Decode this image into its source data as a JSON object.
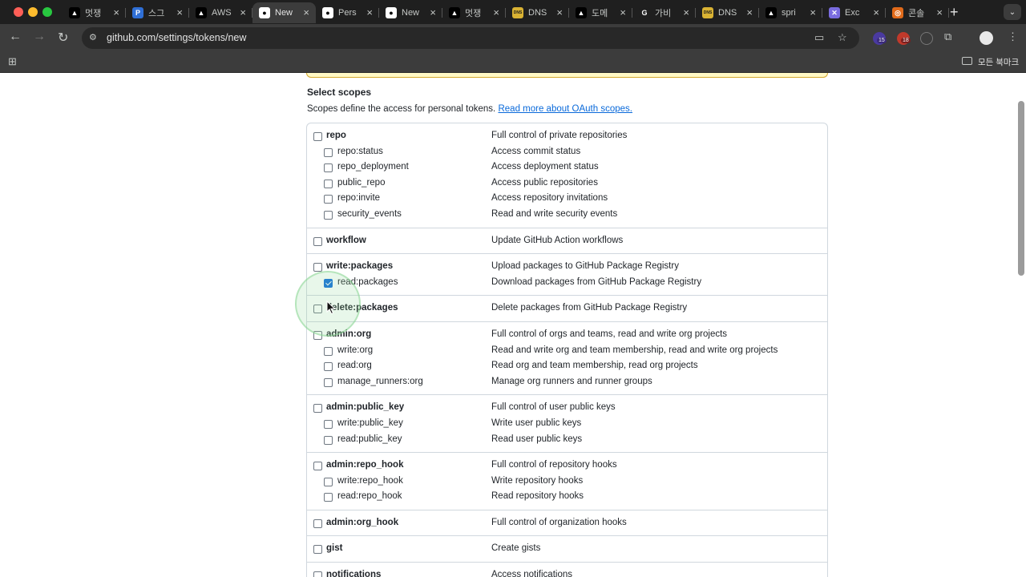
{
  "browser": {
    "tabs": [
      {
        "title": "멋쟁",
        "icon": "triangle-icon",
        "favicon_text": "▲",
        "favicon_bg": "#000000",
        "active": false
      },
      {
        "title": "스그",
        "icon": "p-logo-icon",
        "favicon_text": "P",
        "favicon_bg": "#2f6fd6",
        "active": false
      },
      {
        "title": "AWS",
        "icon": "triangle-icon",
        "favicon_text": "▲",
        "favicon_bg": "#000000",
        "active": false
      },
      {
        "title": "New",
        "icon": "github-icon",
        "favicon_text": "●",
        "favicon_bg": "#ffffff",
        "active": true
      },
      {
        "title": "Pers",
        "icon": "github-icon",
        "favicon_text": "●",
        "favicon_bg": "#ffffff",
        "active": false
      },
      {
        "title": "New",
        "icon": "github-icon",
        "favicon_text": "●",
        "favicon_bg": "#ffffff",
        "active": false
      },
      {
        "title": "멋쟁",
        "icon": "triangle-icon",
        "favicon_text": "▲",
        "favicon_bg": "#000000",
        "active": false
      },
      {
        "title": "DNS",
        "icon": "dns-icon",
        "favicon_text": "DNS",
        "favicon_bg": "#d9b233",
        "active": false
      },
      {
        "title": "도메",
        "icon": "triangle-icon",
        "favicon_text": "▲",
        "favicon_bg": "#000000",
        "active": false
      },
      {
        "title": "가비",
        "icon": "g-letter-icon",
        "favicon_text": "G",
        "favicon_bg": "#1f1f1f",
        "active": false
      },
      {
        "title": "DNS",
        "icon": "dns-icon",
        "favicon_text": "DNS",
        "favicon_bg": "#d9b233",
        "active": false
      },
      {
        "title": "spri",
        "icon": "triangle-icon",
        "favicon_text": "▲",
        "favicon_bg": "#000000",
        "active": false
      },
      {
        "title": "Exc",
        "icon": "excalidraw-icon",
        "favicon_text": "✕",
        "favicon_bg": "#7a6ce0",
        "active": false
      },
      {
        "title": "콘솔",
        "icon": "console-icon",
        "favicon_text": "◎",
        "favicon_bg": "#e06a1a",
        "active": false
      }
    ],
    "url": "github.com/settings/tokens/new",
    "extensions": [
      {
        "icon": "extension-icon",
        "badge": "15",
        "color": "#4a3aa0"
      },
      {
        "icon": "extension-icon",
        "badge": "18",
        "color": "#c0392b"
      }
    ],
    "bookmarks_label": "모든 북마크"
  },
  "page": {
    "select_title": "Select scopes",
    "select_desc": "Scopes define the access for personal tokens.",
    "select_link": "Read more about OAuth scopes.",
    "groups": [
      {
        "name": "repo",
        "desc": "Full control of private repositories",
        "checked": false,
        "children": [
          {
            "name": "repo:status",
            "desc": "Access commit status",
            "checked": false
          },
          {
            "name": "repo_deployment",
            "desc": "Access deployment status",
            "checked": false
          },
          {
            "name": "public_repo",
            "desc": "Access public repositories",
            "checked": false
          },
          {
            "name": "repo:invite",
            "desc": "Access repository invitations",
            "checked": false
          },
          {
            "name": "security_events",
            "desc": "Read and write security events",
            "checked": false
          }
        ]
      },
      {
        "name": "workflow",
        "desc": "Update GitHub Action workflows",
        "checked": false,
        "children": []
      },
      {
        "name": "write:packages",
        "desc": "Upload packages to GitHub Package Registry",
        "checked": false,
        "children": [
          {
            "name": "read:packages",
            "desc": "Download packages from GitHub Package Registry",
            "checked": true
          }
        ]
      },
      {
        "name": "delete:packages",
        "desc": "Delete packages from GitHub Package Registry",
        "checked": false,
        "children": []
      },
      {
        "name": "admin:org",
        "desc": "Full control of orgs and teams, read and write org projects",
        "checked": false,
        "children": [
          {
            "name": "write:org",
            "desc": "Read and write org and team membership, read and write org projects",
            "checked": false
          },
          {
            "name": "read:org",
            "desc": "Read org and team membership, read org projects",
            "checked": false
          },
          {
            "name": "manage_runners:org",
            "desc": "Manage org runners and runner groups",
            "checked": false
          }
        ]
      },
      {
        "name": "admin:public_key",
        "desc": "Full control of user public keys",
        "checked": false,
        "children": [
          {
            "name": "write:public_key",
            "desc": "Write user public keys",
            "checked": false
          },
          {
            "name": "read:public_key",
            "desc": "Read user public keys",
            "checked": false
          }
        ]
      },
      {
        "name": "admin:repo_hook",
        "desc": "Full control of repository hooks",
        "checked": false,
        "children": [
          {
            "name": "write:repo_hook",
            "desc": "Write repository hooks",
            "checked": false
          },
          {
            "name": "read:repo_hook",
            "desc": "Read repository hooks",
            "checked": false
          }
        ]
      },
      {
        "name": "admin:org_hook",
        "desc": "Full control of organization hooks",
        "checked": false,
        "children": []
      },
      {
        "name": "gist",
        "desc": "Create gists",
        "checked": false,
        "children": []
      },
      {
        "name": "notifications",
        "desc": "Access notifications",
        "checked": false,
        "children": []
      }
    ]
  }
}
